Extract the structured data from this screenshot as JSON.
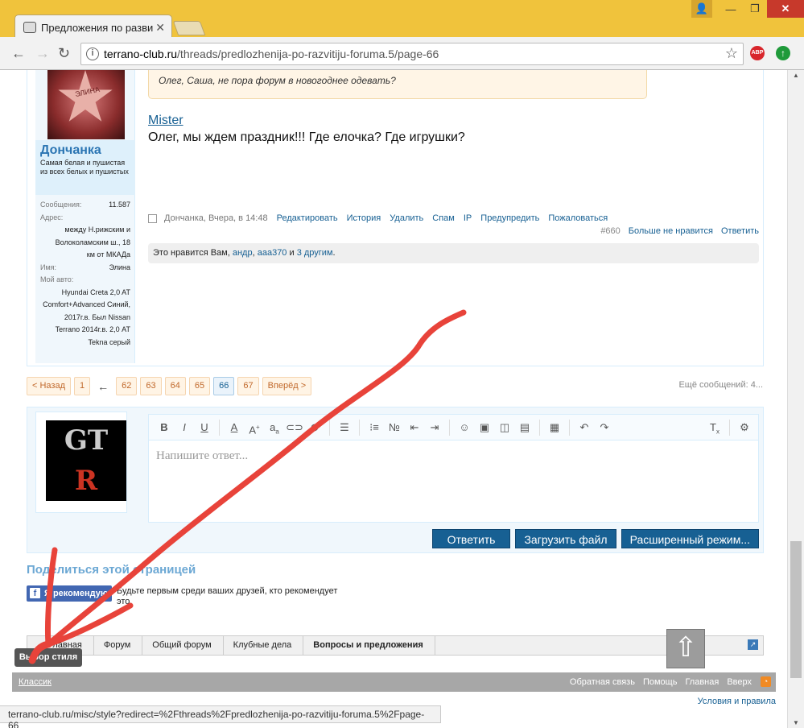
{
  "browser": {
    "tab_title": "Предложения по разви",
    "url_host": "terrano-club.ru",
    "url_path": "/threads/predlozhenija-po-razvitiju-foruma.5/page-66",
    "abp": "ABP",
    "status_url": "terrano-club.ru/misc/style?redirect=%2Fthreads%2Fpredlozhenija-po-razvitiju-foruma.5%2Fpage-66"
  },
  "post": {
    "quote": "Олег, Саша, не пора форум в новогоднее одевать?",
    "author_link": "Mister",
    "text": "Олег, мы ждем праздник!!! Где елочка? Где игрушки?",
    "meta_user": "Дончанка",
    "meta_time": "Вчера, в 14:48",
    "actions": [
      "Редактировать",
      "История",
      "Удалить",
      "Спам",
      "IP",
      "Предупредить",
      "Пожаловаться"
    ],
    "number": "#660",
    "unlike": "Больше не нравится",
    "reply": "Ответить",
    "likes_prefix": "Это нравится Вам, ",
    "likes_user1": "андр",
    "likes_sep": ", ",
    "likes_user2": "ааа370",
    "likes_and": " и ",
    "likes_others": "3 другим",
    "likes_end": "."
  },
  "user": {
    "avatar_text": "ЭЛИНА",
    "name": "Дончанка",
    "title": "Самая белая и пушистая из всех белых и пушистых",
    "messages_label": "Сообщения:",
    "messages": "11.587",
    "address_label": "Адрес:",
    "address": "между Н.рижским и Волоколамским ш., 18 км от МКАДа",
    "name_label": "Имя:",
    "real_name": "Элина",
    "car_label": "Мой авто:",
    "car": "Hyundai Creta 2,0 AT Comfort+Advanced Синий, 2017г.в. Был Nissan Terrano 2014г.в. 2,0 AT Tekna серый"
  },
  "pager": {
    "prev": "< Назад",
    "pages": [
      "1",
      "←",
      "62",
      "63",
      "64",
      "65",
      "66",
      "67"
    ],
    "next": "Вперёд >",
    "more": "Ещё сообщений: 4..."
  },
  "reply": {
    "placeholder": "Напишите ответ...",
    "avatar_top": "GT",
    "avatar_bottom": "R",
    "buttons": [
      "Ответить",
      "Загрузить файл",
      "Расширенный режим..."
    ]
  },
  "share": {
    "title": "Поделиться этой страницей",
    "fb_button": "Я рекомендую",
    "fb_text": "Будьте первым среди ваших друзей, кто рекомендует это."
  },
  "breadcrumbs": [
    "Главная",
    "Форум",
    "Общий форум",
    "Клубные дела",
    "Вопросы и предложения"
  ],
  "tooltip": "Выбор стиля",
  "footer": {
    "style_link": "Классик",
    "links": [
      "Обратная связь",
      "Помощь",
      "Главная",
      "Вверх"
    ],
    "terms": "Условия и правила"
  },
  "colors": {
    "accent": "#176093",
    "annotation_arrow": "#e8433a"
  }
}
